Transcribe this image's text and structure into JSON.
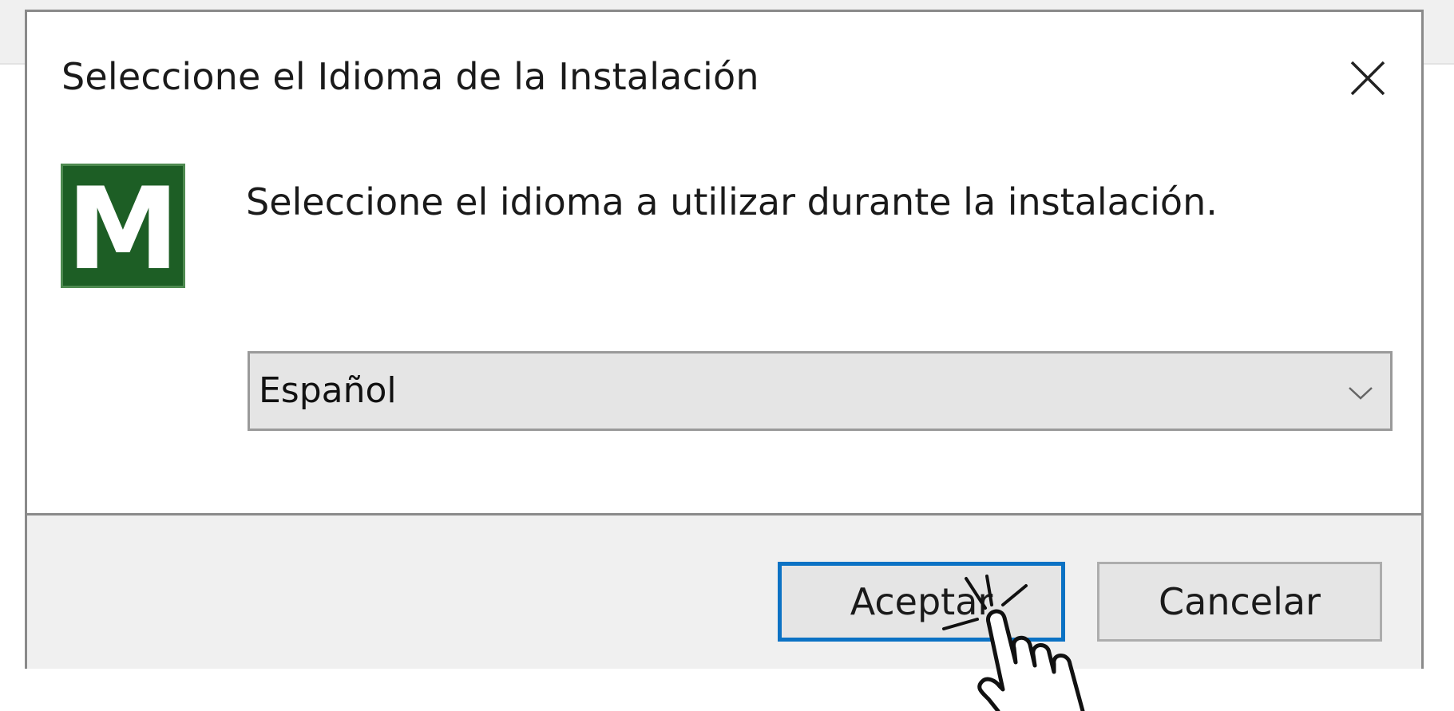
{
  "dialog": {
    "title": "Seleccione el Idioma de la Instalación",
    "message": "Seleccione el idioma a utilizar durante la instalación.",
    "logo_letter": "M",
    "language_select": {
      "selected": "Español"
    },
    "buttons": {
      "ok_label": "Aceptar",
      "cancel_label": "Cancelar"
    },
    "icons": {
      "close": "close-icon",
      "dropdown": "chevron-down-icon",
      "logo": "app-logo",
      "pointer": "hand-pointer-cursor"
    }
  },
  "colors": {
    "focus_border": "#0b72c4",
    "logo_green": "#1d5e25",
    "footer_background": "#f0f0f0"
  }
}
